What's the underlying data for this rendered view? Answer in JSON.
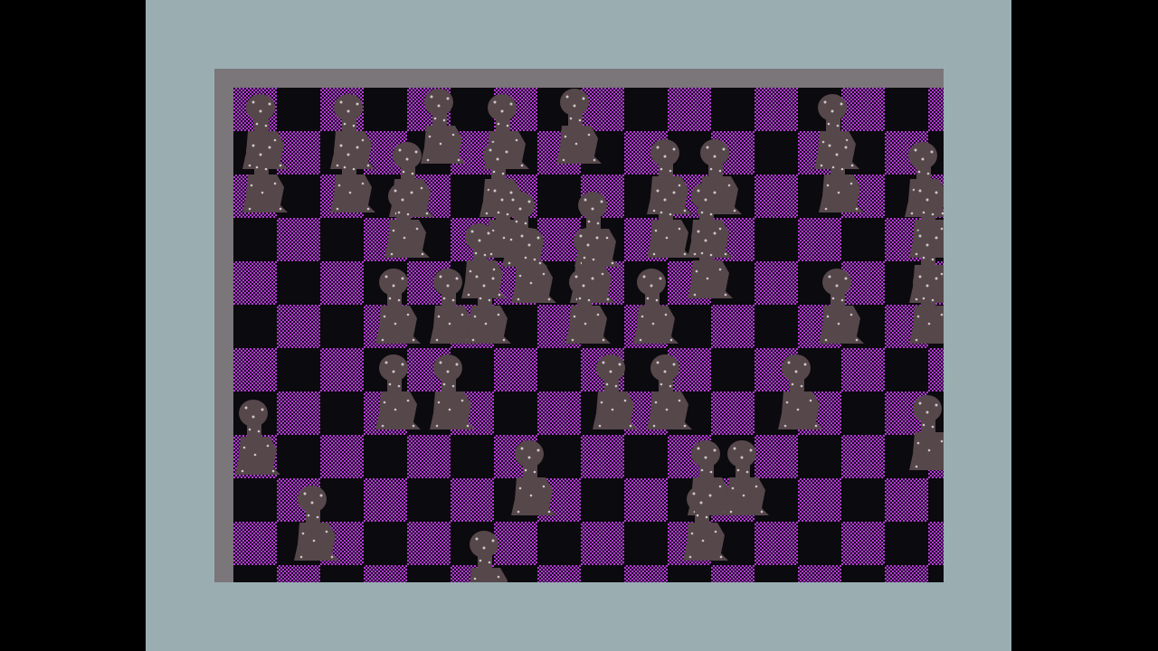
{
  "colors": {
    "frame": "#9aaeb2",
    "border": "#7a767a",
    "tile_purple": "#b43bd6",
    "tile_dark": "#0b0a0e",
    "sprite_body": "#55474a",
    "sprite_dots": "#cfc5c8"
  },
  "board": {
    "rows": 12,
    "cols": 17
  },
  "sprite_icon": "kneeling-figure-icon",
  "sprite_count": 46
}
